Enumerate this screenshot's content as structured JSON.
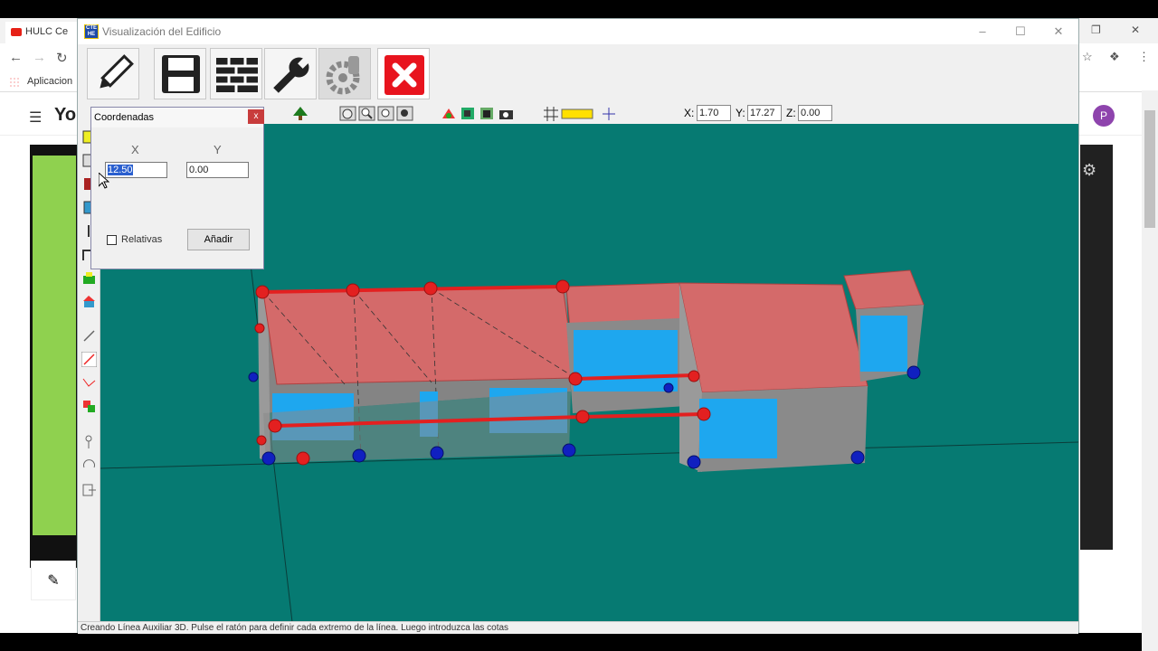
{
  "browser": {
    "tab_label": "HULC Ce",
    "bookmarks_label": "Aplicacion",
    "yt_logo": "You",
    "avatar_letter": "P"
  },
  "window": {
    "title": "Visualización del Edificio",
    "app_icon_text": "CTE HE",
    "min_label": "–",
    "max_label": "☐",
    "close_label": "✕"
  },
  "big_toolbar": [
    {
      "name": "edit-pencil-button",
      "icon": "pencil-icon"
    },
    {
      "name": "save-button",
      "icon": "floppy-disk-icon"
    },
    {
      "name": "wall-construction-button",
      "icon": "brick-wall-icon"
    },
    {
      "name": "tools-button",
      "icon": "wrench-icon"
    },
    {
      "name": "settings-button",
      "icon": "gear-icon"
    },
    {
      "name": "close-view-button",
      "icon": "close-icon"
    }
  ],
  "coords": {
    "x_label": "X:",
    "x_value": "1.70",
    "y_label": "Y:",
    "y_value": "17.27",
    "z_label": "Z:",
    "z_value": "0.00"
  },
  "dialog": {
    "title": "Coordenadas",
    "close_label": "x",
    "x_header": "X",
    "y_header": "Y",
    "x_value": "12.50",
    "y_value": "0.00",
    "relativas_label": "Relativas",
    "add_label": "Añadir"
  },
  "status_text": "Creando Línea Auxiliar 3D. Pulse el ratón para definir cada extremo de la línea. Luego introduzca las cotas",
  "colors": {
    "viewport": "#067a72",
    "roof": "#d46a6a",
    "wall": "#8a8a8a",
    "window": "#1ea7ef",
    "red_node": "#e32020",
    "blue_node": "#1020c0"
  }
}
